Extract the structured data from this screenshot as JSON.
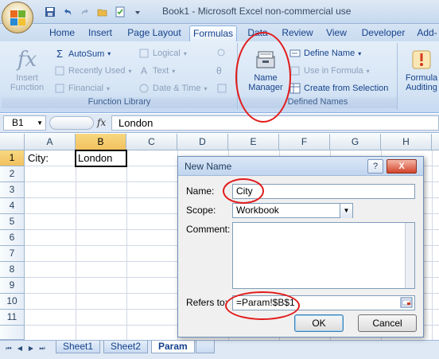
{
  "app": {
    "title": "Book1 - Microsoft Excel non-commercial use"
  },
  "ribbon_tabs": [
    "Home",
    "Insert",
    "Page Layout",
    "Formulas",
    "Data",
    "Review",
    "View",
    "Developer",
    "Add-"
  ],
  "active_tab": "Formulas",
  "function_library": {
    "insert_function": [
      "Insert",
      "Function"
    ],
    "autosum": "AutoSum",
    "recently_used": "Recently Used",
    "financial": "Financial",
    "logical": "Logical",
    "text": "Text",
    "date_time": "Date & Time",
    "label": "Function Library"
  },
  "defined_names": {
    "name_manager": [
      "Name",
      "Manager"
    ],
    "define_name": "Define Name",
    "use_in_formula": "Use in Formula",
    "create_from_selection": "Create from Selection",
    "label": "Defined Names"
  },
  "formula_auditing": {
    "label": [
      "Formula",
      "Auditing"
    ]
  },
  "formula_bar": {
    "name_box": "B1",
    "fx": "fx",
    "value": "London"
  },
  "grid": {
    "columns": [
      "A",
      "B",
      "C",
      "D",
      "E",
      "F",
      "G",
      "H"
    ],
    "rows": [
      "1",
      "2",
      "3",
      "4",
      "5",
      "6",
      "7",
      "8",
      "9",
      "10",
      "11"
    ],
    "selected_column": "B",
    "selected_row": "1",
    "cells": {
      "A1": "City:",
      "B1": "London"
    }
  },
  "sheets": {
    "tabs": [
      "Sheet1",
      "Sheet2",
      "Param"
    ],
    "active": "Param"
  },
  "dialog": {
    "title": "New Name",
    "help_button": "?",
    "close_button": "X",
    "name_label": "Name:",
    "name_value": "City",
    "scope_label": "Scope:",
    "scope_value": "Workbook",
    "comment_label": "Comment:",
    "comment_value": "",
    "refers_to_label": "Refers to:",
    "refers_to_value": "=Param!$B$1",
    "ok": "OK",
    "cancel": "Cancel"
  },
  "colors": {
    "highlight_ellipse": "#e21b1b",
    "selected_header": "#f1c15f",
    "ribbon_text": "#15428b"
  },
  "icons": [
    "office-button-icon",
    "save-icon",
    "undo-icon",
    "redo-icon",
    "open-icon",
    "checklist-icon",
    "insert-function-icon",
    "autosum-icon",
    "name-manager-icon",
    "define-name-icon",
    "formula-auditing-icon"
  ]
}
